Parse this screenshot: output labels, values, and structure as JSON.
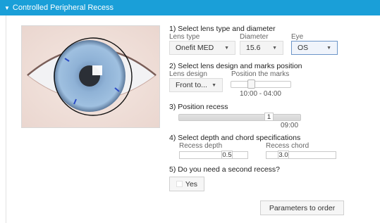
{
  "header": {
    "title": "Controlled Peripheral Recess"
  },
  "step1": {
    "title": "1) Select lens type and diameter",
    "lens_type_label": "Lens type",
    "lens_type_value": "Onefit MED",
    "diameter_label": "Diameter",
    "diameter_value": "15.6",
    "eye_label": "Eye",
    "eye_value": "OS"
  },
  "step2": {
    "title": "2) Select lens design and marks position",
    "lens_design_label": "Lens design",
    "lens_design_value": "Front to...",
    "marks_label": "Position the marks",
    "marks_value": "10:00 - 04:00"
  },
  "step3": {
    "title": "3) Position recess",
    "recess_number": "1",
    "recess_time": "09:00"
  },
  "step4": {
    "title": "4) Select depth and chord specifications",
    "depth_label": "Recess depth",
    "depth_value": "0.5",
    "chord_label": "Recess chord",
    "chord_value": "3.0"
  },
  "step5": {
    "title": "5) Do you need a second recess?",
    "yes_label": "Yes"
  },
  "footer": {
    "params_button": "Parameters to order"
  },
  "icons": {
    "header_caret": "caret-down-icon",
    "dropdown_caret": "caret-down-icon"
  },
  "colors": {
    "header_bg": "#1a9fd8",
    "iris": "#8fb2d6",
    "marks": "#2a49c6"
  }
}
